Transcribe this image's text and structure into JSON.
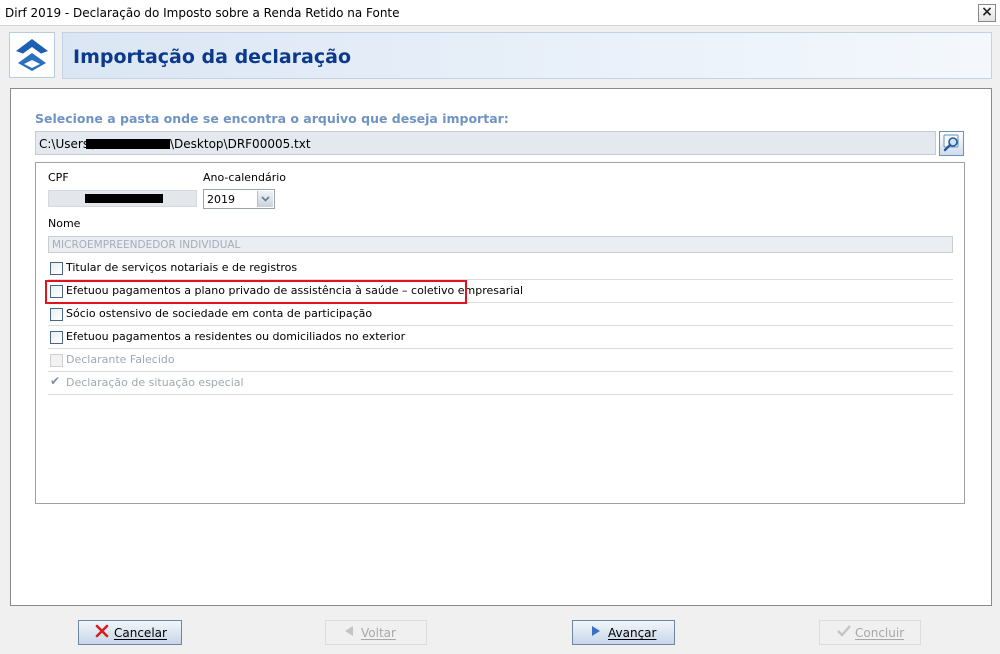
{
  "window": {
    "title": "Dirf 2019 - Declaração do Imposto sobre a Renda Retido na Fonte",
    "close_label": "×"
  },
  "header": {
    "title": "Importação da declaração",
    "logo": "receita-federal-logo"
  },
  "form": {
    "prompt": "Selecione a pasta onde se encontra o arquivo que deseja importar:",
    "path_prefix": "C:\\Users\\",
    "path_suffix": "\\Desktop\\DRF00005.txt",
    "cpf_label": "CPF",
    "year_label": "Ano-calendário",
    "year_value": "2019",
    "name_label": "Nome",
    "name_value": "MICROEMPREENDEDOR INDIVIDUAL"
  },
  "checkboxes": [
    {
      "label": "Titular de serviços notariais e de registros",
      "checked": false,
      "enabled": true
    },
    {
      "label": "Efetuou pagamentos a plano privado de assistência à saúde – coletivo empresarial",
      "checked": false,
      "enabled": true,
      "highlighted": true
    },
    {
      "label": "Sócio ostensivo de sociedade em conta de participação",
      "checked": false,
      "enabled": true
    },
    {
      "label": "Efetuou pagamentos a residentes ou domiciliados no exterior",
      "checked": false,
      "enabled": true
    },
    {
      "label": "Declarante Falecido",
      "checked": false,
      "enabled": false
    },
    {
      "label": "Declaração de situação especial",
      "checked": true,
      "enabled": false
    }
  ],
  "footer": {
    "cancel": "Cancelar",
    "back": "Voltar",
    "next": "Avançar",
    "finish": "Concluir"
  },
  "colors": {
    "accent": "#0b3a8c",
    "prompt": "#6f94c4",
    "highlight": "#e0131e",
    "cancel_icon": "#d42020",
    "next_icon": "#3a6fc4"
  }
}
